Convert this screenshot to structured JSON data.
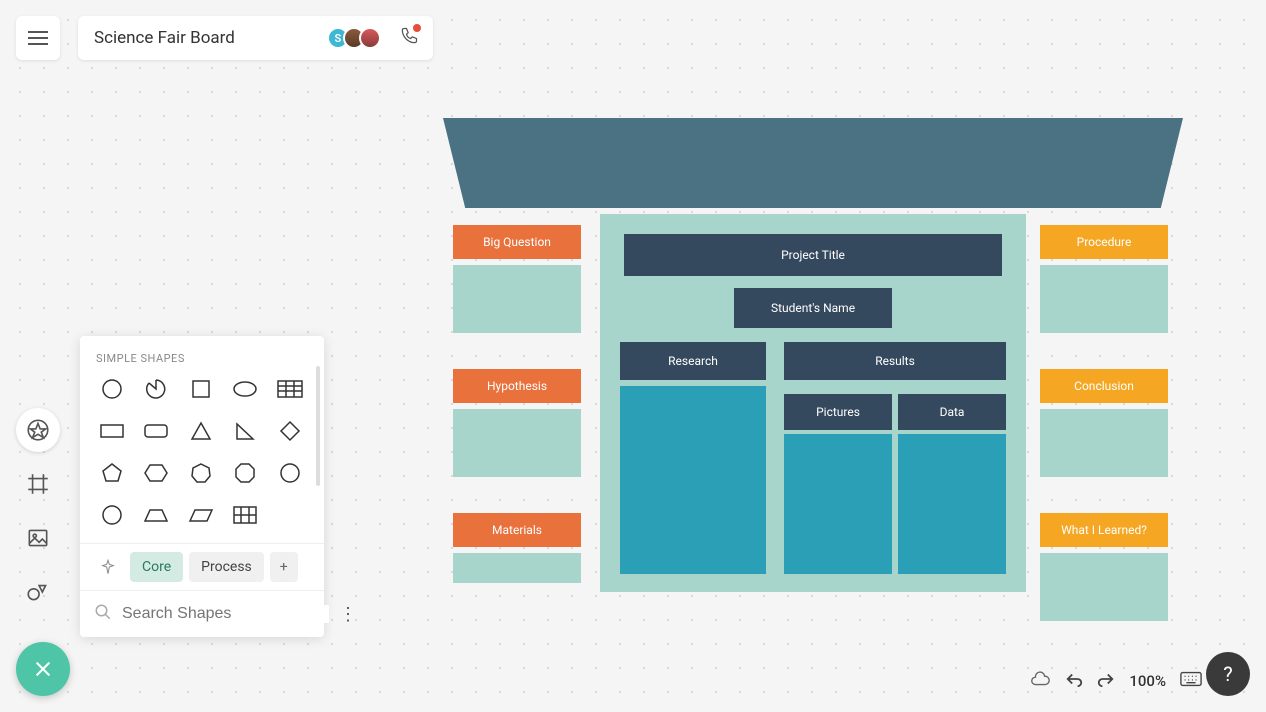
{
  "header": {
    "title": "Science Fair Board",
    "avatar_initial": "S"
  },
  "shapes_panel": {
    "section_label": "SIMPLE SHAPES",
    "tabs": {
      "core": "Core",
      "process": "Process"
    },
    "search_placeholder": "Search Shapes"
  },
  "board": {
    "left": [
      {
        "label": "Big Question"
      },
      {
        "label": "Hypothesis"
      },
      {
        "label": "Materials"
      }
    ],
    "right": [
      {
        "label": "Procedure"
      },
      {
        "label": "Conclusion"
      },
      {
        "label": "What I Learned?"
      }
    ],
    "center": {
      "title": "Project Title",
      "name": "Student's Name",
      "research": "Research",
      "results": "Results",
      "pictures": "Pictures",
      "data": "Data"
    }
  },
  "footer": {
    "zoom": "100%",
    "help": "?"
  },
  "colors": {
    "orange": "#e8713c",
    "amber": "#f5a623",
    "teal_light": "#a8d5cb",
    "teal_dark": "#2a9fb5",
    "navy": "#35495e",
    "header_blue": "#4a7282",
    "mint": "#4fc5a7"
  }
}
